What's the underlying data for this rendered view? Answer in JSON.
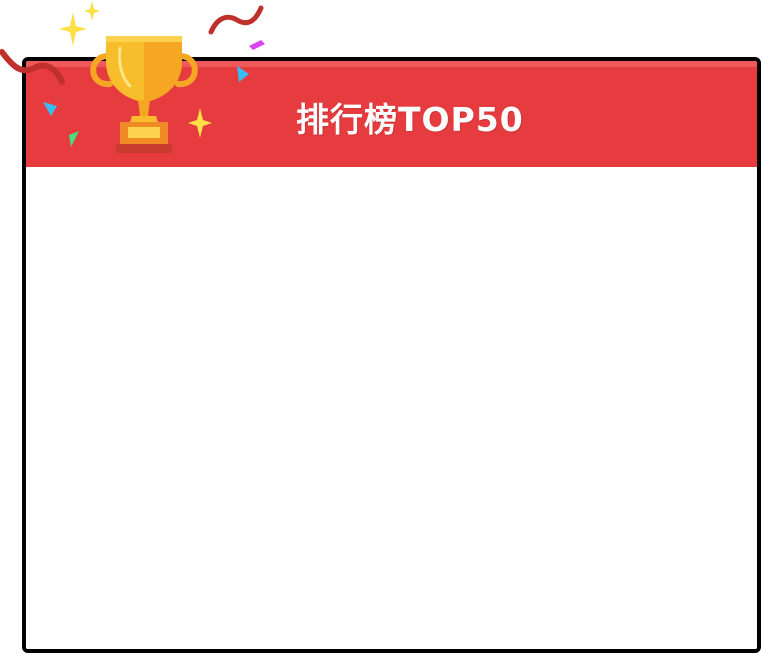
{
  "leaderboard": {
    "title": "排行榜TOP50",
    "header_color": "#e63c3f",
    "icons": [
      "trophy-icon",
      "sparkle-icon",
      "confetti-icon"
    ]
  }
}
